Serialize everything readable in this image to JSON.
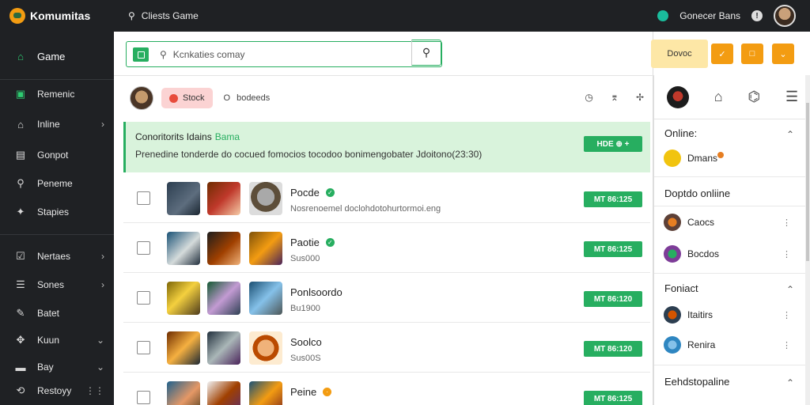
{
  "app": {
    "name": "Komumitas"
  },
  "topbar": {
    "search_label": "Cliests Game",
    "user_label": "Gonecer Bans"
  },
  "sidebar": {
    "items": [
      {
        "label": "Game",
        "icon": "home-icon",
        "glyph": "⌂",
        "active": true
      },
      {
        "label": "Remenic",
        "icon": "gamepad-icon",
        "glyph": "▣"
      },
      {
        "label": "Inline",
        "icon": "home-icon",
        "glyph": "⌂",
        "chevron": "›"
      },
      {
        "label": "Gonpot",
        "icon": "list-icon",
        "glyph": "▤"
      },
      {
        "label": "Peneme",
        "icon": "search-icon",
        "glyph": "⚲"
      },
      {
        "label": "Stapies",
        "icon": "puzzle-icon",
        "glyph": "✦"
      },
      {
        "label": "Nertaes",
        "icon": "checklist-icon",
        "glyph": "☑",
        "chevron": "›"
      },
      {
        "label": "Sones",
        "icon": "menu-icon",
        "glyph": "☰",
        "chevron": "›"
      },
      {
        "label": "Batet",
        "icon": "edit-icon",
        "glyph": "✎"
      },
      {
        "label": "Kuun",
        "icon": "tools-icon",
        "glyph": "✥",
        "chevron": "⌄"
      },
      {
        "label": "Bay",
        "icon": "folder-icon",
        "glyph": "▬",
        "chevron": "⌄"
      },
      {
        "label": "Restoyy",
        "icon": "history-icon",
        "glyph": "⟲",
        "chevron": "⋮⋮"
      }
    ]
  },
  "search": {
    "placeholder": "Kcnkaties comay"
  },
  "filter": {
    "chip_label": "Stock",
    "text_a": "O",
    "text_b": "bodeeds"
  },
  "banner": {
    "title": "Conoritorits Idains",
    "title_accent": "Bama",
    "body": "Prenedine tonderde do cocued fomocios tocodoo bonimengobater Jdoitono(23:30)",
    "button": "HDE ⊕ +"
  },
  "rows": [
    {
      "name": "Pocde",
      "sub": "Nosrenoemel doclohdotohurtormoi.eng",
      "badge": "green",
      "button": "MT  86:125"
    },
    {
      "name": "Paotie",
      "sub": "Sus000",
      "badge": "green",
      "button": "MT  86:125"
    },
    {
      "name": "Ponlsoordo",
      "sub": "Bu1900",
      "badge": "",
      "button": "MT  86:120"
    },
    {
      "name": "Soolco",
      "sub": "Sus00S",
      "badge": "",
      "button": "MT  86:120"
    },
    {
      "name": "Peine",
      "sub": "",
      "badge": "orange",
      "button": "MT  86:125"
    }
  ],
  "right_top": {
    "label": "Dovoc",
    "btn1": "✓",
    "btn2": "□",
    "btn3": "⌄"
  },
  "right_panel": {
    "sections": [
      {
        "title": "Online:",
        "items": [
          {
            "name": "Dmans",
            "color": "#f1c40f"
          }
        ]
      },
      {
        "title": "Doptdo onliine",
        "items": [
          {
            "name": "Caocs",
            "color": "#8e5a2b"
          },
          {
            "name": "Bocdos",
            "color": "#7d3c98"
          }
        ]
      },
      {
        "title": "Foniact",
        "items": [
          {
            "name": "Itaitirs",
            "color": "#2c3e50"
          },
          {
            "name": "Renira",
            "color": "#2e86c1"
          }
        ]
      },
      {
        "title": "Eehdstopaline",
        "items": []
      }
    ]
  },
  "colors": {
    "accent": "#27ae60",
    "sidebar_bg": "#1f2124",
    "warning": "#f39c12"
  }
}
